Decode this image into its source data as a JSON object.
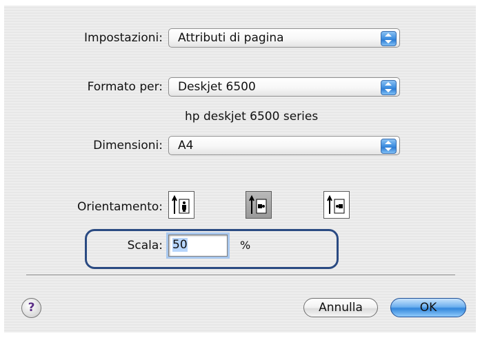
{
  "settings": {
    "label": "Impostazioni:",
    "value": "Attributi di pagina"
  },
  "format_for": {
    "label": "Formato per:",
    "value": "Deskjet 6500",
    "printer_description": "hp deskjet 6500 series"
  },
  "paper_size": {
    "label": "Dimensioni:",
    "value": "A4"
  },
  "orientation": {
    "label": "Orientamento:",
    "options": [
      "portrait",
      "landscape",
      "reverse-landscape"
    ],
    "selected": "landscape"
  },
  "scale": {
    "label": "Scala:",
    "value": "50",
    "unit": "%"
  },
  "buttons": {
    "help": "?",
    "cancel": "Annulla",
    "ok": "OK"
  },
  "colors": {
    "accent_blue": "#3487dc",
    "focus_ring": "#2a4a82"
  }
}
